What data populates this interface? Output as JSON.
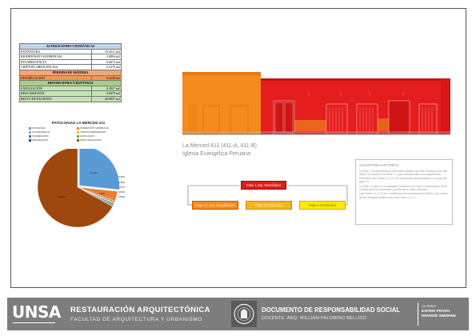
{
  "table": {
    "header_alt": "ALTERACIONES CROMÁTICAS",
    "alt_rows": [
      {
        "label": "PATINATURA",
        "value": "19.4511 m2"
      },
      {
        "label": "BIODEPÓSITO SUPERFICIAL",
        "value": "2.8894 m2"
      },
      {
        "label": "EFLORESCENCIA",
        "value": "0.6673 m2"
      },
      {
        "label": "CRIPTOFLORESCENCIAS",
        "value": "0.2379 m2"
      }
    ],
    "header_perdida": "PÉRDIDA DE MATERIA",
    "perdida_rows": [
      {
        "label": "DISGREGACIÓN",
        "value": "0.4258 m2"
      }
    ],
    "header_depos": "DEPOSICIONES Y RUPTURAS",
    "depos_rows": [
      {
        "label": "EXFOLIACIÓN",
        "value": "0.3937 m2"
      },
      {
        "label": "DESCAMACIÓN",
        "value": "0.0479 m2"
      },
      {
        "label": "RESTO DE FACHADA",
        "value": "48.8837 m2"
      }
    ]
  },
  "chart_data": {
    "type": "pie",
    "title": "PATOLOGIAS LA MERCED 411",
    "categories": [
      "PATINATURA",
      "BIODEPÓSITO SUPERFICIAL",
      "EFLORESCENCIA",
      "CRIPTOFLORESCENCIAS",
      "DISGREGACIÓN",
      "EXFOLIACIÓN",
      "DESCAMACIÓN",
      "RESTO DE FACHADA"
    ],
    "values": [
      26.14,
      3.88,
      0.9,
      0.32,
      0.57,
      0.53,
      0.06,
      65.69
    ],
    "labels": [
      "26,14%",
      "3,88%",
      "0,90%",
      "0,32%",
      "0,57%",
      "0,53%",
      "0,06%",
      "65,69%"
    ],
    "colors": [
      "#5b9bd5",
      "#ed7d31",
      "#a5a5a5",
      "#ffc000",
      "#4472c4",
      "#70ad47",
      "#264478",
      "#9e480e"
    ],
    "legend_position": "top"
  },
  "caption": {
    "title": "La Merced 411 (411-A, 411-B)",
    "subtitle": "Iglesia Evangélica Peruana"
  },
  "diagram": {
    "box_top": "Fase 1 Arq. Neoclásico",
    "box_1": "Fase 2.1 Arq. Republicana",
    "box_2": "Fase 2.2 Ecléctica",
    "box_3": "Fase 2.3 Ecléctico"
  },
  "algoritmo": {
    "title": "ALGORITMO HISTÓRICO",
    "p1": "La Fase 1 perteneciente al Neoclásico surgiría por los comienzos de este último, en cambio a la Fase 2.1 que corresponde a una arquitectura ecléctica y las Fases 2.2 y 2.3 se encuentran desarrolladas a lo largo del siglo XX.",
    "p2": "La Fase 2.1 que es un agregado posterior a la Fase 1 continuación de la cornisa para sus ventanas y puerta de su estilo ecléctico.",
    "p3": "Las Fases 2.2 y 2.3 son modificaciones eclécticas del edificio y los vanos de las ventanas posteriores a las Fases 1 y 2.1."
  },
  "footer": {
    "logo": "UNSA",
    "course": "RESTAURACIÓN ARQUITECTÓNICA",
    "faculty": "FACULTAD DE ARQUITECTURA Y URBANISMO",
    "doc_title": "DOCUMENTO DE RESPONSABILIDAD SOCIAL",
    "docente": "DOCENTE: ARQ. WILLIAM PALOMINO BELLIDO",
    "alumna_label": "ALUMNA:",
    "alumna_name": "ESPINO PRADO DENISSE SIMONNE"
  },
  "colors": {
    "phase1": "#e01b1b",
    "phase21": "#f78a1d",
    "phase22": "#f6b520",
    "phase23": "#ffea00",
    "footer": "#7d7d7d"
  }
}
